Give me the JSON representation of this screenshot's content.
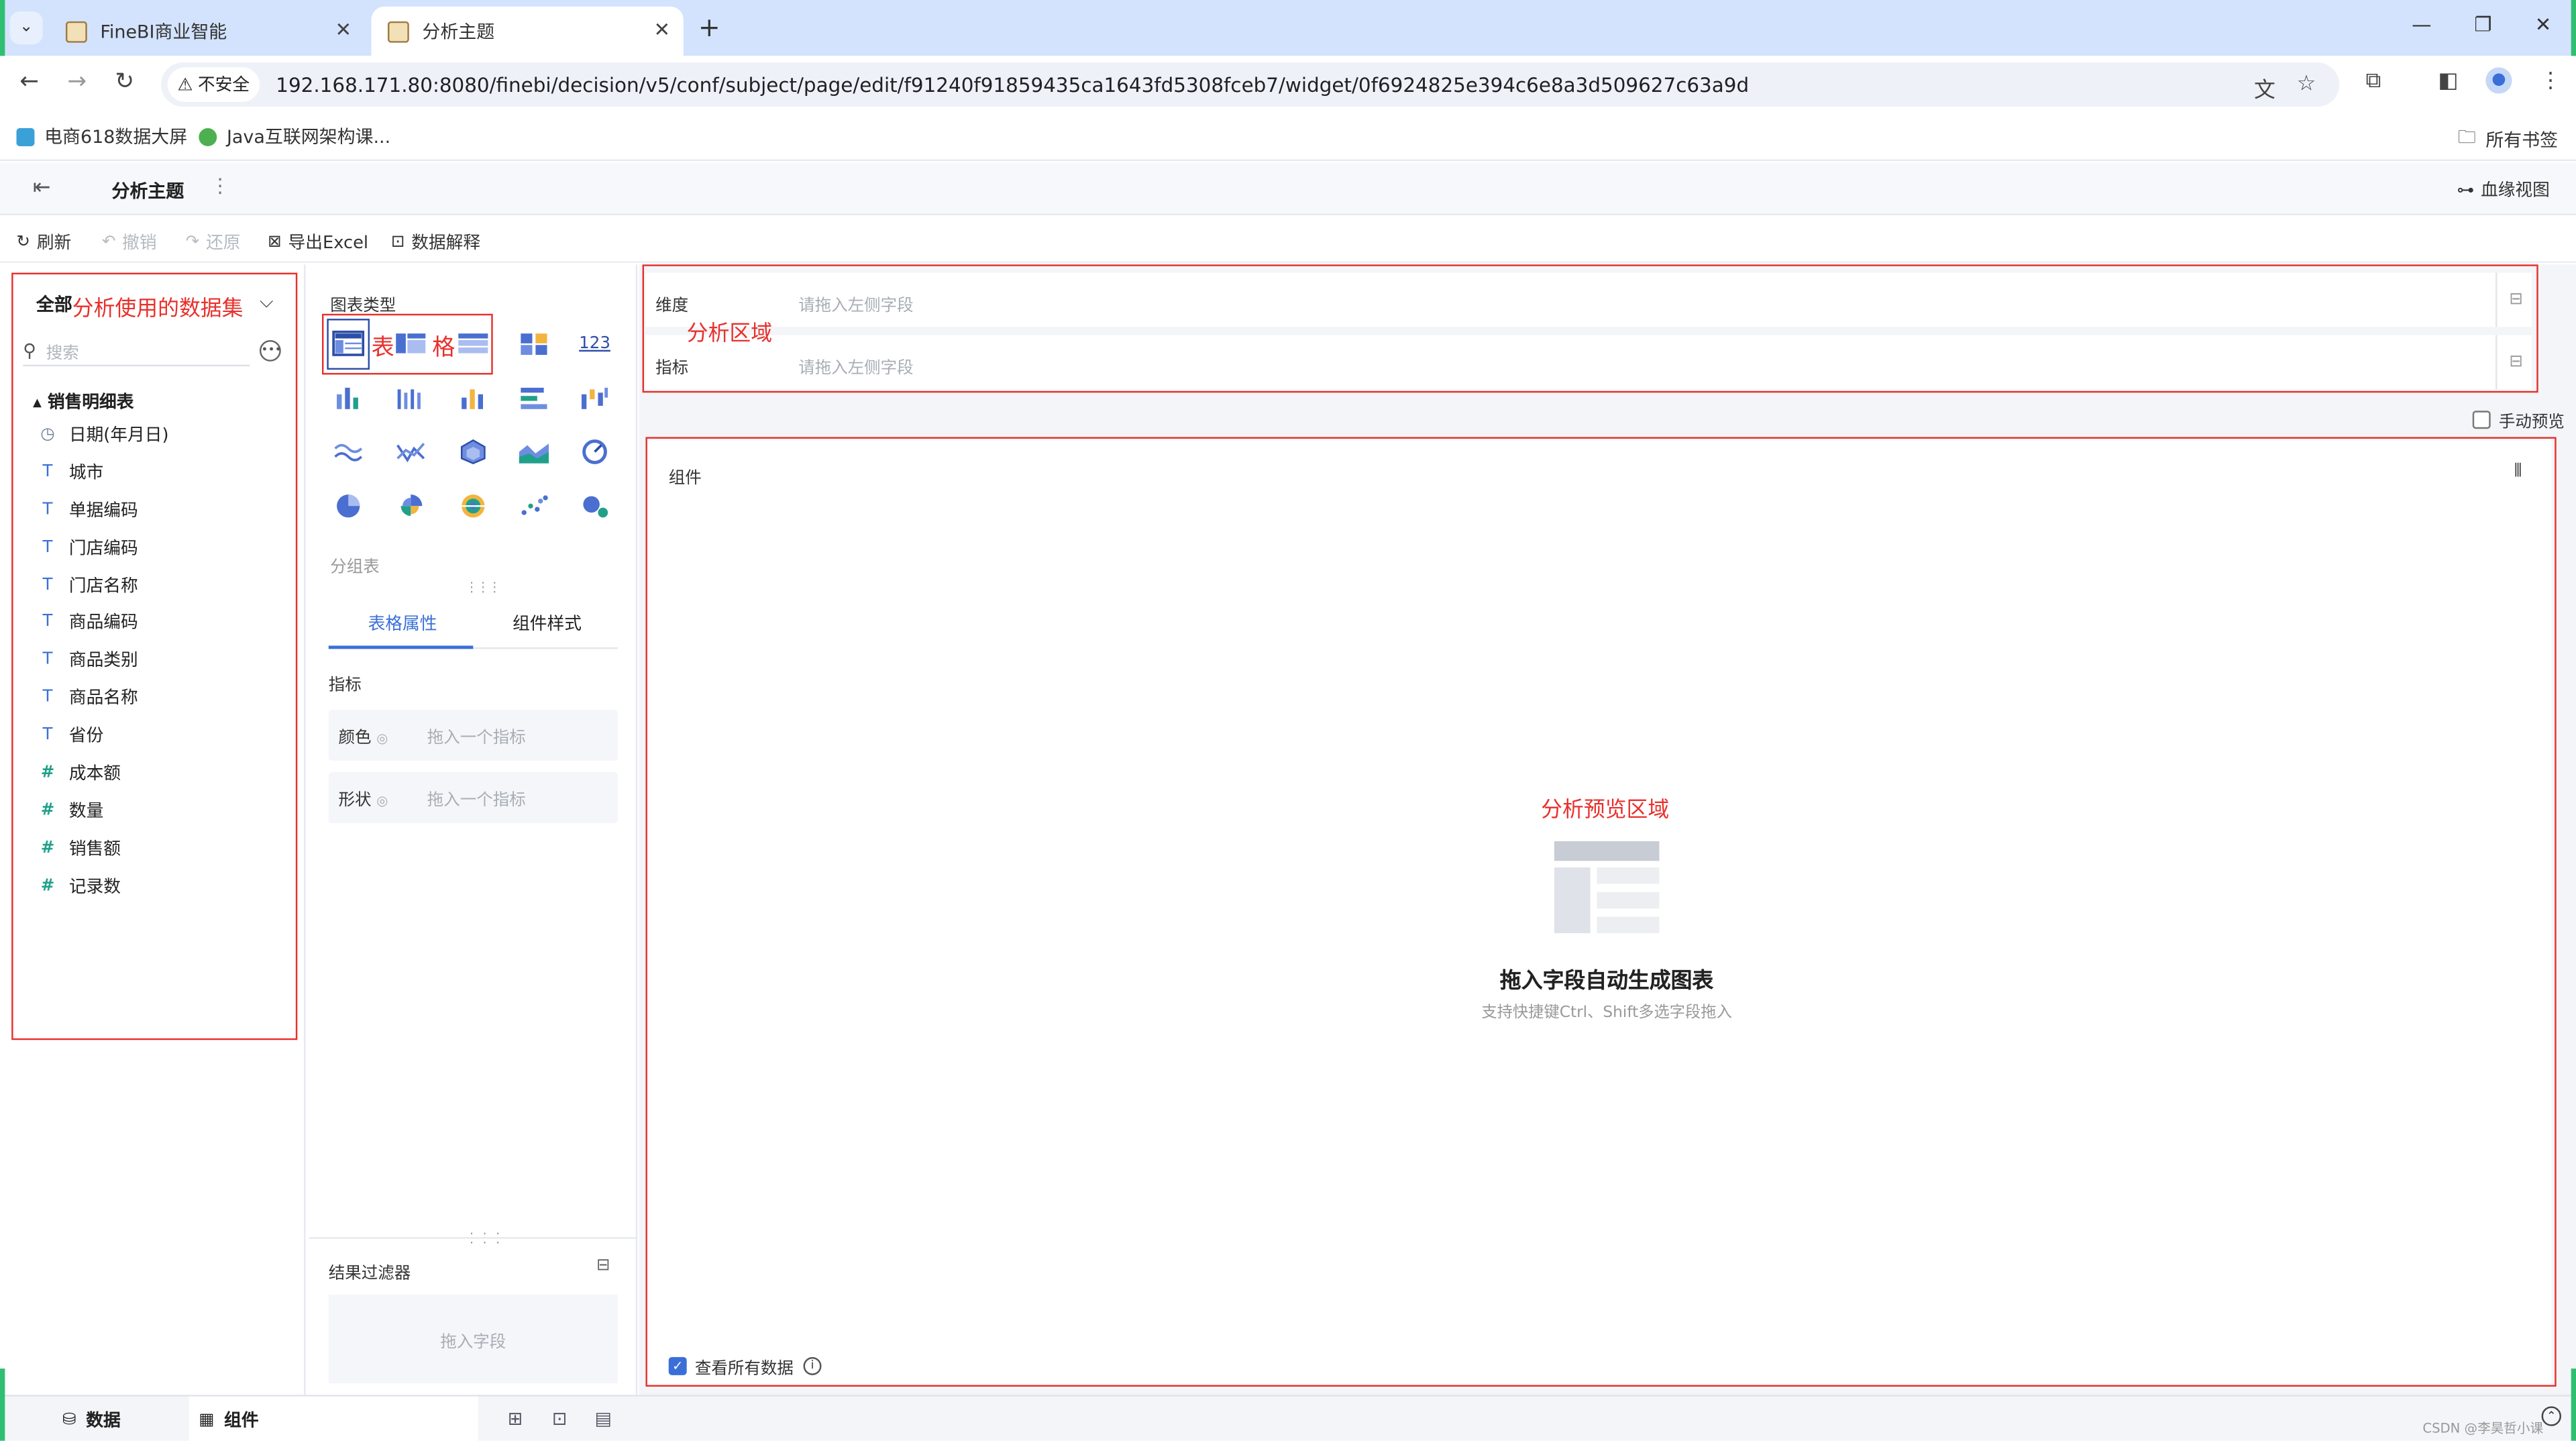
{
  "browser": {
    "tabs": [
      {
        "label": "FineBI商业智能",
        "active": false
      },
      {
        "label": "分析主题",
        "active": true
      }
    ],
    "security_label": "不安全",
    "url": "192.168.171.80:8080/finebi/decision/v5/conf/subject/page/edit/f91240f91859435ca1643fd5308fceb7/widget/0f6924825e394c6e8a3d509627c63a9d",
    "bookmarks": [
      "电商618数据大屏",
      "Java互联网架构课..."
    ],
    "all_bookmarks": "所有书签"
  },
  "app": {
    "title": "分析主题",
    "lineage_view": "血缘视图",
    "toolbar": {
      "refresh": "刷新",
      "undo": "撤销",
      "redo": "还原",
      "export_excel": "导出Excel",
      "data_explain": "数据解释"
    }
  },
  "left_panel": {
    "scope": "全部",
    "annotation": "分析使用的数据集",
    "search_placeholder": "搜索",
    "table_name": "销售明细表",
    "fields": [
      {
        "name": "日期(年月日)",
        "type": "date",
        "icon": "clock-icon"
      },
      {
        "name": "城市",
        "type": "text",
        "icon": "text-icon"
      },
      {
        "name": "单据编码",
        "type": "text",
        "icon": "text-icon"
      },
      {
        "name": "门店编码",
        "type": "text",
        "icon": "text-icon"
      },
      {
        "name": "门店名称",
        "type": "text",
        "icon": "text-icon"
      },
      {
        "name": "商品编码",
        "type": "text",
        "icon": "text-icon"
      },
      {
        "name": "商品类别",
        "type": "text",
        "icon": "text-icon"
      },
      {
        "name": "商品名称",
        "type": "text",
        "icon": "text-icon"
      },
      {
        "name": "省份",
        "type": "text",
        "icon": "text-icon"
      },
      {
        "name": "成本额",
        "type": "number",
        "icon": "hash-icon"
      },
      {
        "name": "数量",
        "type": "number",
        "icon": "hash-icon"
      },
      {
        "name": "销售额",
        "type": "number",
        "icon": "hash-icon"
      },
      {
        "name": "记录数",
        "type": "number",
        "icon": "hash-icon"
      }
    ]
  },
  "mid_panel": {
    "chart_type_label": "图表类型",
    "table_annotation_1": "表",
    "table_annotation_2": "格",
    "selected_chart_name": "分组表",
    "tabs": [
      "表格属性",
      "组件样式"
    ],
    "metric_label": "指标",
    "slots": [
      {
        "label": "颜色",
        "placeholder": "拖入一个指标"
      },
      {
        "label": "形状",
        "placeholder": "拖入一个指标"
      }
    ],
    "filter_label": "结果过滤器",
    "filter_placeholder": "拖入字段"
  },
  "right_area": {
    "dimension_label": "维度",
    "dimension_placeholder": "请拖入左侧字段",
    "metric_label": "指标",
    "metric_placeholder": "请拖入左侧字段",
    "area_annotation": "分析区域",
    "manual_preview": "手动预览",
    "component_label": "组件",
    "preview_annotation": "分析预览区域",
    "empty_title": "拖入字段自动生成图表",
    "empty_subtitle": "支持快捷键Ctrl、Shift多选字段拖入",
    "view_all_data": "查看所有数据"
  },
  "bottom": {
    "data_tab": "数据",
    "component_tab": "组件",
    "credit": "CSDN @李昊哲小课"
  },
  "colors": {
    "annotation_red": "#e8302c",
    "accent_blue": "#3a6fd8",
    "number_field_green": "#20a08a"
  }
}
